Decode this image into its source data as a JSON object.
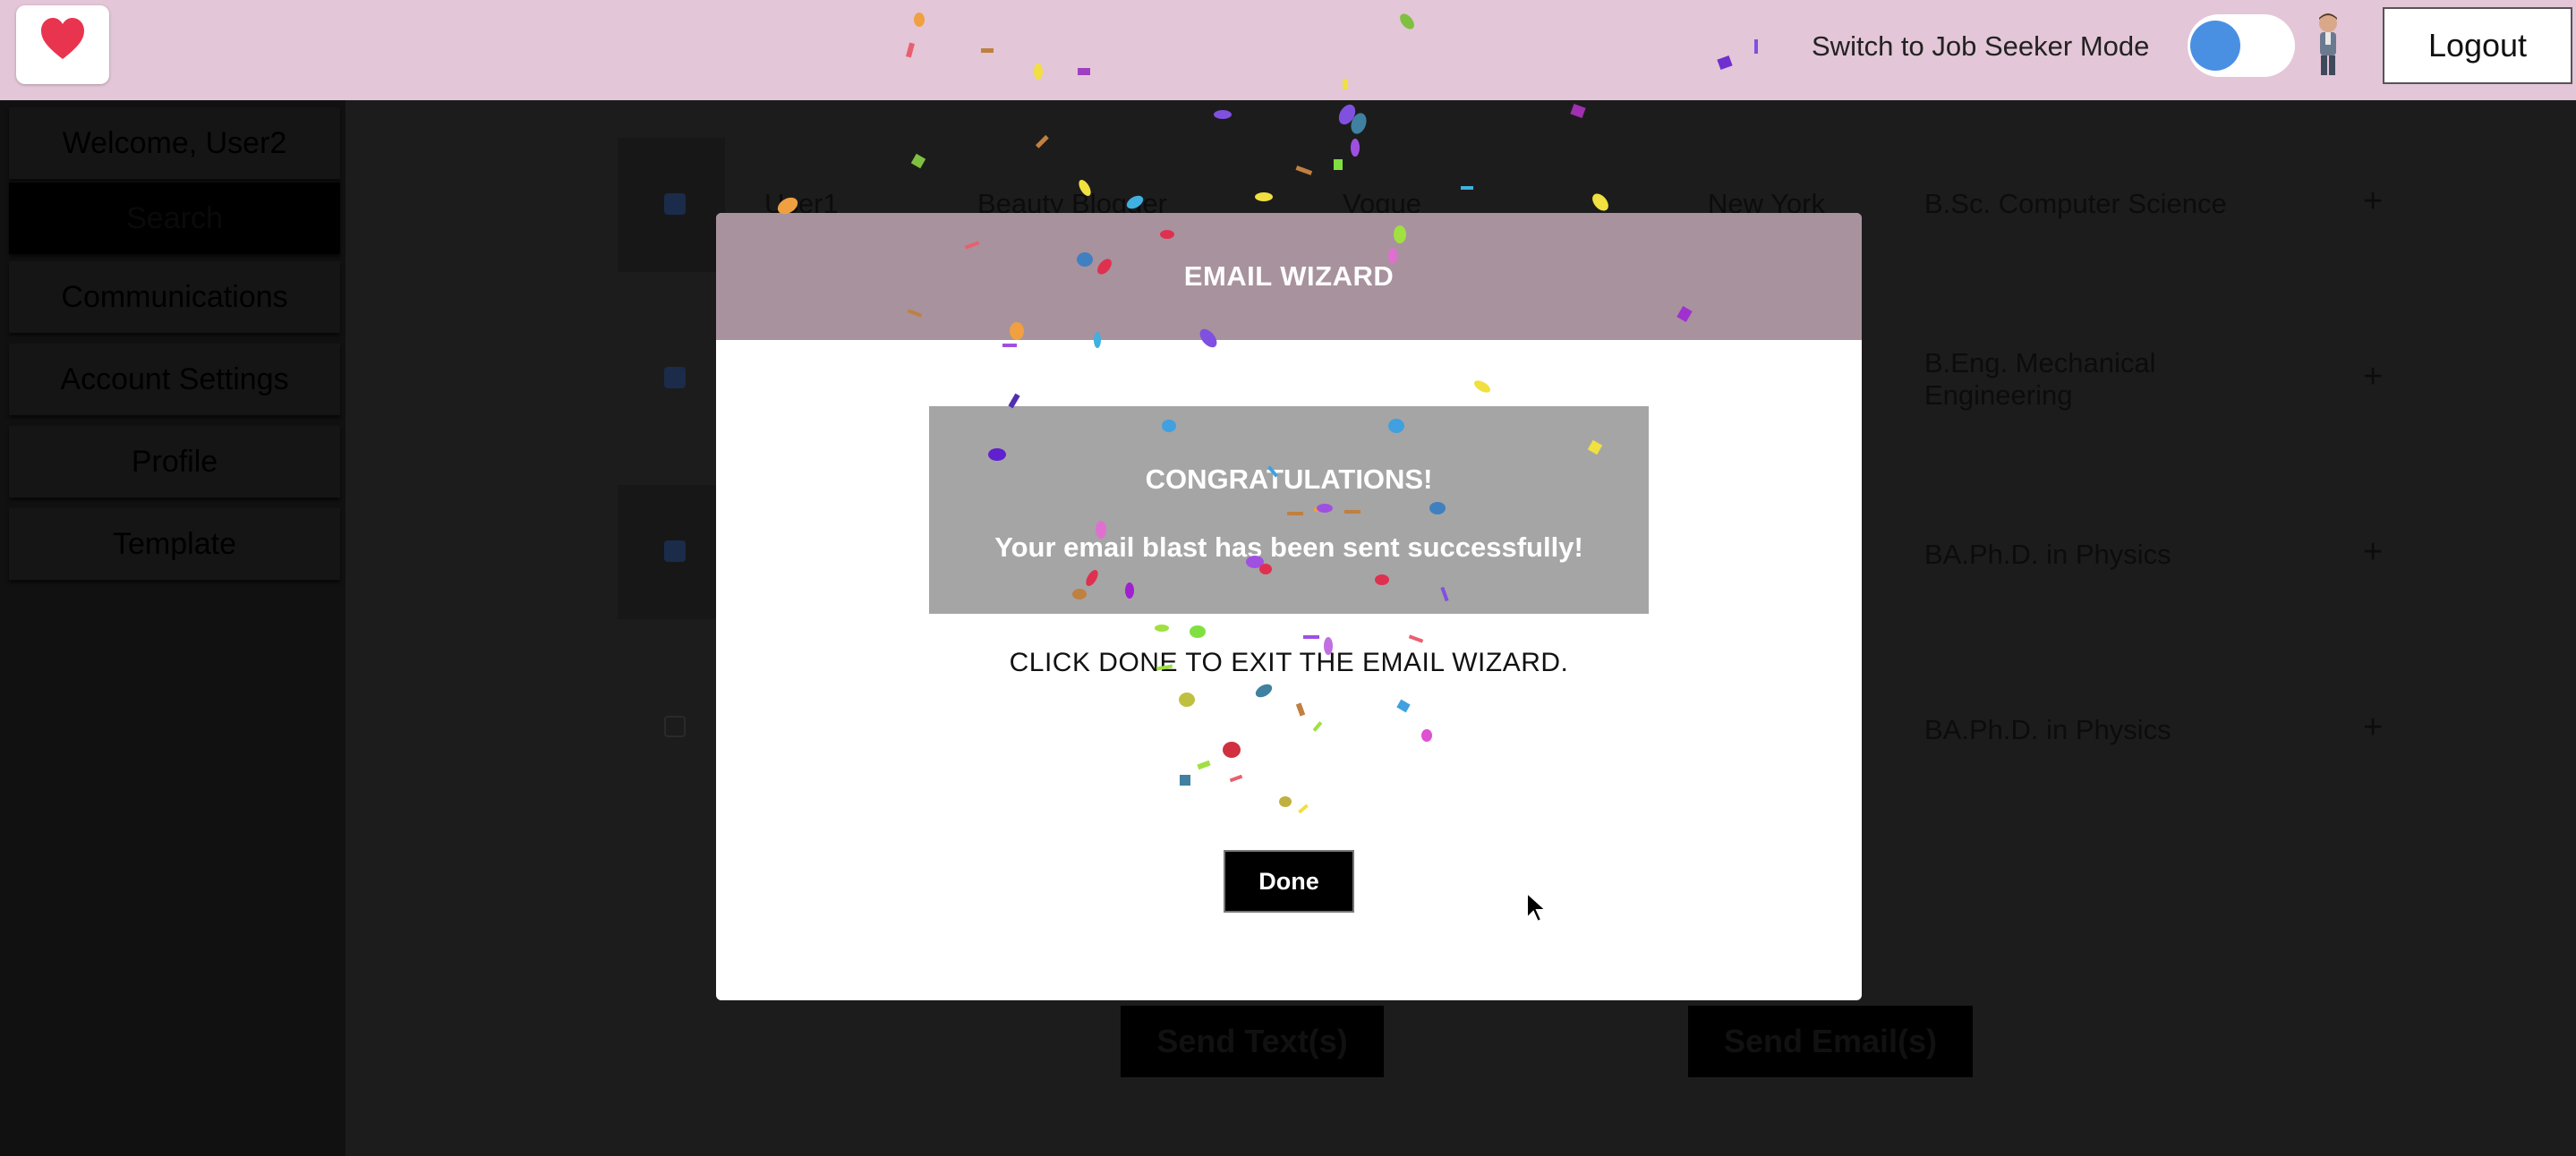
{
  "header": {
    "mode_label": "Switch to Job Seeker Mode",
    "logout_label": "Logout",
    "toggle_color": "#4a90e2",
    "logo_color": "#e8344e"
  },
  "sidebar": {
    "items": [
      {
        "label": "Welcome, User2"
      },
      {
        "label": "Search"
      },
      {
        "label": "Communications"
      },
      {
        "label": "Account Settings"
      },
      {
        "label": "Profile"
      },
      {
        "label": "Template"
      }
    ]
  },
  "table": {
    "rows": [
      {
        "checked": true,
        "name": "User1",
        "title": "Beauty Blogger",
        "company": "Vogue",
        "location": "New York",
        "education": "B.Sc. Computer Science"
      },
      {
        "checked": true,
        "education_line1": "B.Eng. Mechanical",
        "education_line2": "Engineering"
      },
      {
        "checked": true,
        "education": "BA.Ph.D. in Physics"
      },
      {
        "checked": false,
        "education": "BA.Ph.D. in Physics"
      }
    ],
    "plus_symbol": "+"
  },
  "actions": {
    "send_text_label": "Send Text(s)",
    "send_email_label": "Send Email(s)"
  },
  "modal": {
    "title": "EMAIL WIZARD",
    "congrats_heading": "CONGRATULATIONS!",
    "congrats_message": "Your email blast has been sent successfully!",
    "instruction": "CLICK DONE TO EXIT THE EMAIL WIZARD.",
    "done_label": "Done"
  }
}
